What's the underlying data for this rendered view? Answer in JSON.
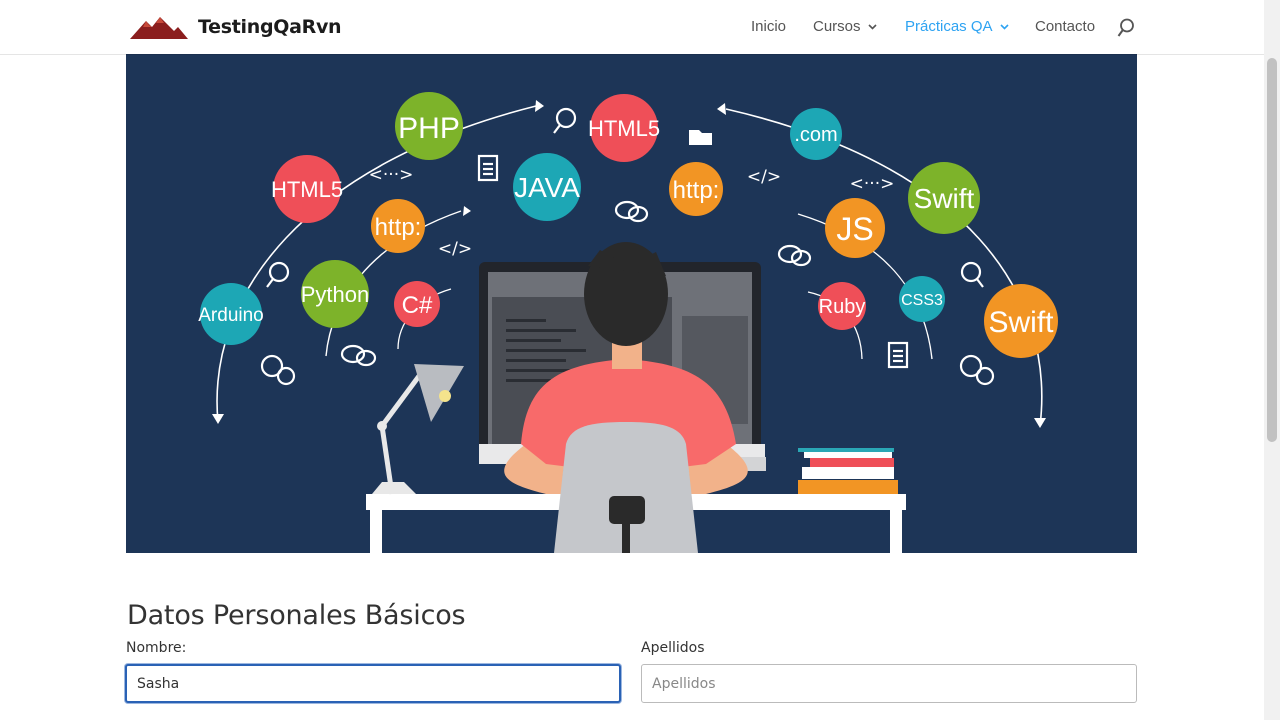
{
  "site": {
    "brand": "TestingQaRvn"
  },
  "nav": {
    "items": [
      {
        "label": "Inicio",
        "has_dropdown": false,
        "active": false
      },
      {
        "label": "Cursos",
        "has_dropdown": true,
        "active": false
      },
      {
        "label": "Prácticas QA",
        "has_dropdown": true,
        "active": true
      },
      {
        "label": "Contacto",
        "has_dropdown": false,
        "active": false
      }
    ],
    "search_icon": "search-icon"
  },
  "hero": {
    "bubbles": [
      "PHP",
      "HTML5",
      "HTML5",
      "JAVA",
      "http:",
      "http:",
      ".com",
      "Swift",
      "JS",
      "Python",
      "Arduino",
      "C#",
      "Ruby",
      "CSS3",
      "Swift"
    ],
    "code_tags": [
      "<···>",
      "</>",
      "</>",
      "<···>",
      "</>"
    ]
  },
  "form": {
    "title": "Datos Personales Básicos",
    "nombre": {
      "label": "Nombre:",
      "value": "Sasha",
      "placeholder": ""
    },
    "apellidos": {
      "label": "Apellidos",
      "value": "",
      "placeholder": "Apellidos"
    }
  },
  "colors": {
    "accent": "#2ea3f2",
    "hero_bg": "#1d3557"
  }
}
